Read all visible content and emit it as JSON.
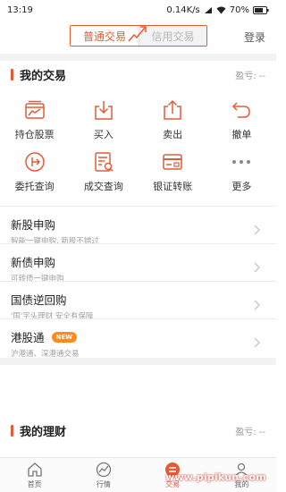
{
  "status_bar": {
    "time": "13:19",
    "network_speed": "0.14K/s",
    "battery": "70%"
  },
  "header": {
    "tabs": [
      {
        "label": "普通交易",
        "active": true
      },
      {
        "label": "信用交易",
        "active": false
      }
    ],
    "login_label": "登录"
  },
  "my_trade": {
    "title": "我的交易",
    "pnl": "盈亏: --",
    "actions": [
      {
        "label": "持仓股票",
        "icon": "holdings-chart-icon"
      },
      {
        "label": "买入",
        "icon": "buy-tray-icon"
      },
      {
        "label": "卖出",
        "icon": "sell-tray-icon"
      },
      {
        "label": "撤单",
        "icon": "undo-arrow-icon"
      },
      {
        "label": "委托查询",
        "icon": "exit-circle-icon"
      },
      {
        "label": "成交查询",
        "icon": "deal-query-icon"
      },
      {
        "label": "银证转账",
        "icon": "bank-card-icon"
      },
      {
        "label": "更多",
        "icon": "more-dots-icon"
      }
    ]
  },
  "services": [
    {
      "title": "新股申购",
      "subtitle": "智能一键申购, 新股不错过"
    },
    {
      "title": "新债申购",
      "subtitle": "可转债一键申购"
    },
    {
      "title": "国债逆回购",
      "subtitle": "'国'字头理财 安全有保障"
    },
    {
      "title": "港股通",
      "badge": "NEW",
      "subtitle": "沪港通、深港通交易"
    }
  ],
  "my_finance": {
    "title": "我的理财",
    "pnl": "盈亏: --"
  },
  "tabbar": {
    "tabs": [
      {
        "label": "首页",
        "icon": "home-icon",
        "active": false
      },
      {
        "label": "行情",
        "icon": "market-icon",
        "active": false
      },
      {
        "label": "交易",
        "icon": "trade-icon",
        "active": true
      },
      {
        "label": "我的",
        "icon": "profile-icon",
        "active": false
      }
    ]
  },
  "watermark": "www.pipikun.com",
  "colors": {
    "accent": "#e45a35",
    "badge": "#ff8a20"
  }
}
